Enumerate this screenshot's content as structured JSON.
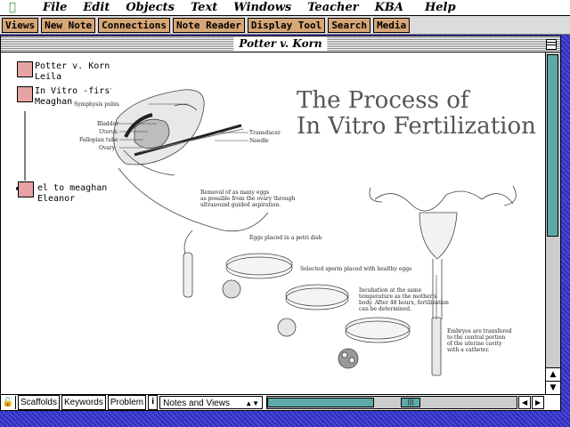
{
  "menubar": {
    "items": [
      "File",
      "Edit",
      "Objects",
      "Text",
      "Windows",
      "Teacher",
      "KBA",
      "Help"
    ]
  },
  "toolbar": {
    "buttons": [
      "Views",
      "New Note",
      "Connections",
      "Note Reader",
      "Display Tool",
      "Search",
      "Media"
    ]
  },
  "window": {
    "title": "Potter v. Korn"
  },
  "notes": [
    {
      "line1": "Potter v. Korn",
      "line2": "Leila"
    },
    {
      "line1": "In Vitro -first sket",
      "line2": "Meaghan"
    },
    {
      "line1": "el to meaghan",
      "line2": "Eleanor"
    }
  ],
  "diagram": {
    "title_line1": "The Process of",
    "title_line2": "In Vitro Fertilization",
    "labels": {
      "symphysis": "Symphysis pubis",
      "bladder": "Bladder",
      "uterus": "Uterus",
      "fallopian": "Fallopian tube",
      "ovary": "Ovary",
      "transducer": "Transducer",
      "needle": "Needle",
      "step1_a": "Removal of as many eggs",
      "step1_b": "as possible from the ovary through",
      "step1_c": "ultrasound guided aspiration.",
      "step2": "Eggs placed in a petri dish",
      "step3": "Selected sperm placed with healthy eggs",
      "step4_a": "Incubation at the same",
      "step4_b": "temperature as the mother's",
      "step4_c": "body. After 48 hours, fertilization",
      "step4_d": "can be determined.",
      "step5_a": "Embryos are transfered",
      "step5_b": "to the central portion",
      "step5_c": "of the uterine cavity",
      "step5_d": "with a catheter."
    }
  },
  "bottombar": {
    "buttons": [
      "Scaffolds",
      "Keywords",
      "Problem"
    ],
    "info": "i",
    "view_select": "Notes and Views"
  },
  "colors": {
    "toolbar_button": "#d6a676",
    "note_box": "#e7a3a3",
    "scroll_thumb": "#5fa8a8",
    "desktop": "#3a3ac8"
  }
}
